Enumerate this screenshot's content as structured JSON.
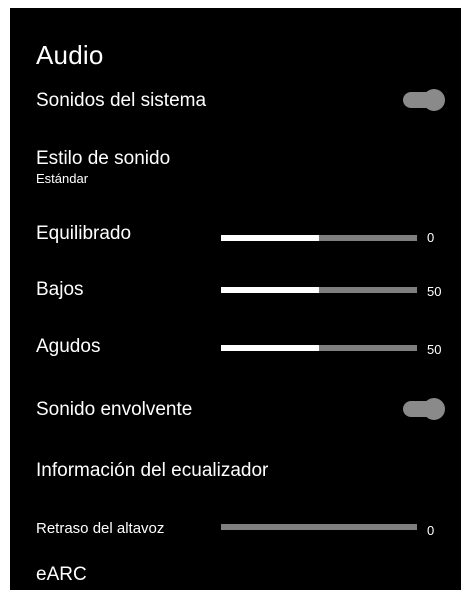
{
  "title": "Audio",
  "items": {
    "system_sounds": {
      "label": "Sonidos del sistema",
      "enabled": true
    },
    "sound_style": {
      "label": "Estilo de sonido",
      "value": "Estándar"
    },
    "balance": {
      "label": "Equilibrado",
      "value": "0",
      "fill": 0.5
    },
    "bass": {
      "label": "Bajos",
      "value": "50",
      "fill": 0.5
    },
    "treble": {
      "label": "Agudos",
      "value": "50",
      "fill": 0.5
    },
    "surround": {
      "label": "Sonido envolvente",
      "enabled": true
    },
    "equalizer": {
      "label": "Información del ecualizador"
    },
    "speaker_delay": {
      "label": "Retraso del altavoz",
      "value": "0",
      "fill": 0
    },
    "earc": {
      "label": "eARC"
    }
  },
  "colors": {
    "background": "#000000",
    "text": "#ffffff",
    "track": "#7f7f7f",
    "toggle": "#8a8a8a"
  }
}
